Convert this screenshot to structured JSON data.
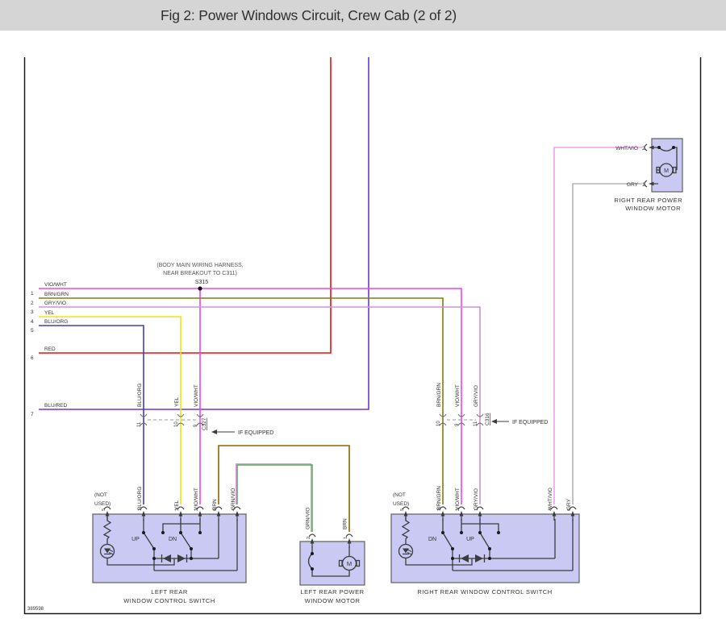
{
  "title": "Fig 2: Power Windows Circuit, Crew Cab (2 of 2)",
  "doc_number": "389598",
  "colors": {
    "vio_wht": "#ee44ee",
    "brn_grn": "#7e7e14",
    "gry_vio": "#cf92d8",
    "yel": "#f2e60a",
    "blu_org": "#3d3dc8",
    "red": "#e81111",
    "blu_red": "#7733cc",
    "brn": "#8f6400",
    "grn_vio": "#55a555",
    "grn_vio_stripe": "#e090e0",
    "wht_vio": "#f0a0f0",
    "gry": "#b3b3b3",
    "box_fill": "#c9c9f4",
    "box_stroke": "#5f5f5f",
    "caption": "#4a5fd0",
    "connector": "#7b9ce8",
    "circuit": "#3c3c3c"
  },
  "harness_note": {
    "line1": "(BODY MAIN WIRING HARNESS,",
    "line2": "NEAR BREAKOUT TO C311)",
    "splice": "S315"
  },
  "left_wires": [
    {
      "n": "1",
      "label": "VIO/WHT"
    },
    {
      "n": "2",
      "label": "BRN/GRN"
    },
    {
      "n": "3",
      "label": "GRY/VIO"
    },
    {
      "n": "4",
      "label": "YEL"
    },
    {
      "n": "5",
      "label": "BLU/ORG"
    },
    {
      "n": "6",
      "label": "RED"
    },
    {
      "n": "7",
      "label": "BLU/RED"
    }
  ],
  "c327": {
    "id": "C327",
    "note": "IF EQUIPPED",
    "pins": [
      "11",
      "10",
      "9"
    ]
  },
  "c316": {
    "id": "C316",
    "note": "IF EQUIPPED",
    "pins": [
      "10",
      "9",
      "11"
    ]
  },
  "mid_left_labels": [
    "BLU/ORG",
    "YEL",
    "VIO/WHT"
  ],
  "lower_left_labels": [
    "BLU/ORG",
    "YEL",
    "VIO/WHT",
    "BRN",
    "GRN/VIO"
  ],
  "mid_right_labels": [
    "BRN/GRN",
    "VIO/WHT",
    "GRY/VIO"
  ],
  "lower_right_labels": [
    "BRN/GRN",
    "VIO/WHT",
    "GRY/VIO",
    "WHT/VIO",
    "GRY"
  ],
  "left_switch": {
    "caption1": "LEFT REAR",
    "caption2": "WINDOW CONTROL SWITCH",
    "not_used1": "(NOT",
    "not_used2": "USED)",
    "up": "UP",
    "dn": "DN",
    "pins": [
      "5",
      "1",
      "3",
      "2",
      "6",
      "4"
    ]
  },
  "right_switch": {
    "caption": "RIGHT REAR WINDOW CONTROL SWITCH",
    "not_used1": "(NOT",
    "not_used2": "USED)",
    "dn": "DN",
    "up": "UP",
    "pins": [
      "5",
      "3",
      "2",
      "1",
      "4",
      "6"
    ]
  },
  "left_motor": {
    "caption1": "LEFT REAR POWER",
    "caption2": "WINDOW MOTOR",
    "m": "M",
    "pins": [
      {
        "n": "2",
        "label": "GRN/VIO"
      },
      {
        "n": "1",
        "label": "BRN"
      }
    ]
  },
  "right_motor": {
    "caption1": "RIGHT REAR POWER",
    "caption2": "WINDOW MOTOR",
    "m": "M",
    "pins": [
      {
        "n": "2",
        "label": "WHT/VIO"
      },
      {
        "n": "1",
        "label": "GRY"
      }
    ]
  }
}
